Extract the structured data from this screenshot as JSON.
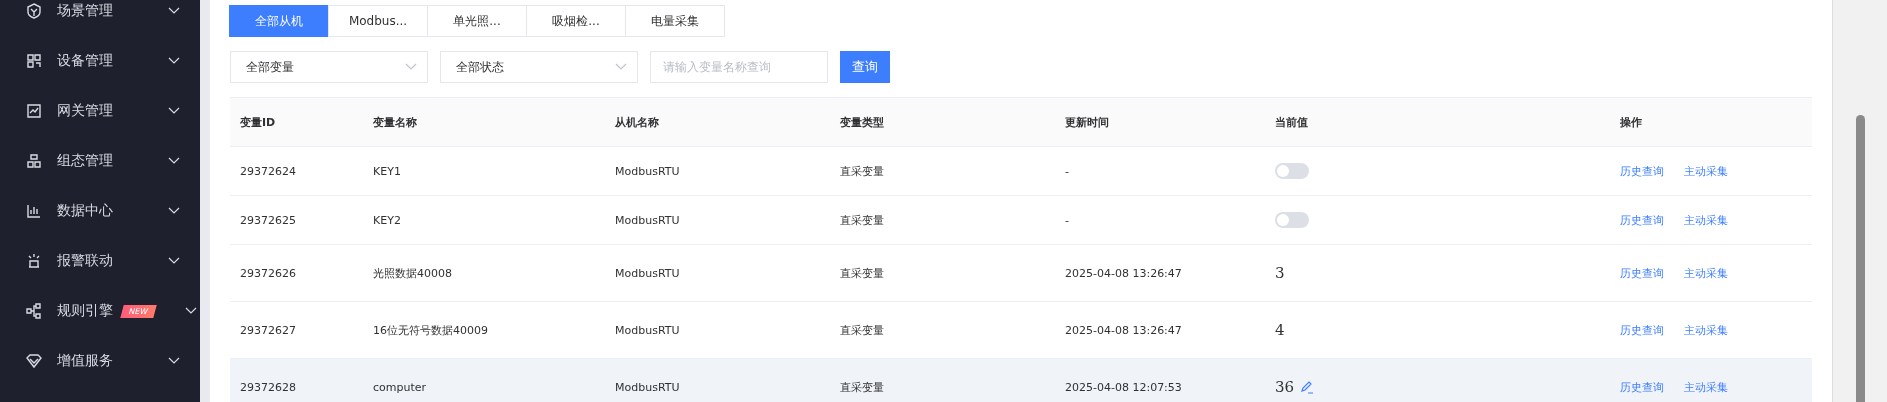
{
  "sidebar": {
    "items": [
      {
        "label": "场景管理"
      },
      {
        "label": "设备管理"
      },
      {
        "label": "网关管理"
      },
      {
        "label": "组态管理"
      },
      {
        "label": "数据中心"
      },
      {
        "label": "报警联动"
      },
      {
        "label": "规则引擎",
        "badge": "NEW"
      },
      {
        "label": "增值服务"
      }
    ]
  },
  "tabs": [
    {
      "label": "全部从机",
      "selected": true
    },
    {
      "label": "Modbus...",
      "selected": false
    },
    {
      "label": "单光照...",
      "selected": false
    },
    {
      "label": "吸烟检...",
      "selected": false
    },
    {
      "label": "电量采集",
      "selected": false
    }
  ],
  "filters": [
    {
      "value": "全部变量"
    },
    {
      "value": "全部状态"
    }
  ],
  "search": {
    "placeholder": "请输入变量名称查询"
  },
  "search_button": "查询",
  "table": {
    "columns": [
      "变量ID",
      "变量名称",
      "从机名称",
      "变量类型",
      "更新时间",
      "当前值",
      "操作"
    ],
    "rows": [
      {
        "id": "29372624",
        "name": "KEY1",
        "slave": "ModbusRTU",
        "type": "直采变量",
        "time": "-",
        "value": {
          "kind": "switch",
          "on": false
        },
        "actions": [
          "历史查询",
          "主动采集"
        ],
        "highlighted": false
      },
      {
        "id": "29372625",
        "name": "KEY2",
        "slave": "ModbusRTU",
        "type": "直采变量",
        "time": "-",
        "value": {
          "kind": "switch",
          "on": false
        },
        "actions": [
          "历史查询",
          "主动采集"
        ],
        "highlighted": false
      },
      {
        "id": "29372626",
        "name": "光照数据40008",
        "slave": "ModbusRTU",
        "type": "直采变量",
        "time": "2025-04-08 13:26:47",
        "value": {
          "kind": "number",
          "text": "3",
          "editable": false
        },
        "actions": [
          "历史查询",
          "主动采集"
        ],
        "highlighted": false
      },
      {
        "id": "29372627",
        "name": "16位无符号数据40009",
        "slave": "ModbusRTU",
        "type": "直采变量",
        "time": "2025-04-08 13:26:47",
        "value": {
          "kind": "number",
          "text": "4",
          "editable": false
        },
        "actions": [
          "历史查询",
          "主动采集"
        ],
        "highlighted": false
      },
      {
        "id": "29372628",
        "name": "computer",
        "slave": "ModbusRTU",
        "type": "直采变量",
        "time": "2025-04-08 12:07:53",
        "value": {
          "kind": "number",
          "text": "36",
          "editable": true
        },
        "actions": [
          "历史查询",
          "主动采集"
        ],
        "highlighted": true
      }
    ]
  }
}
